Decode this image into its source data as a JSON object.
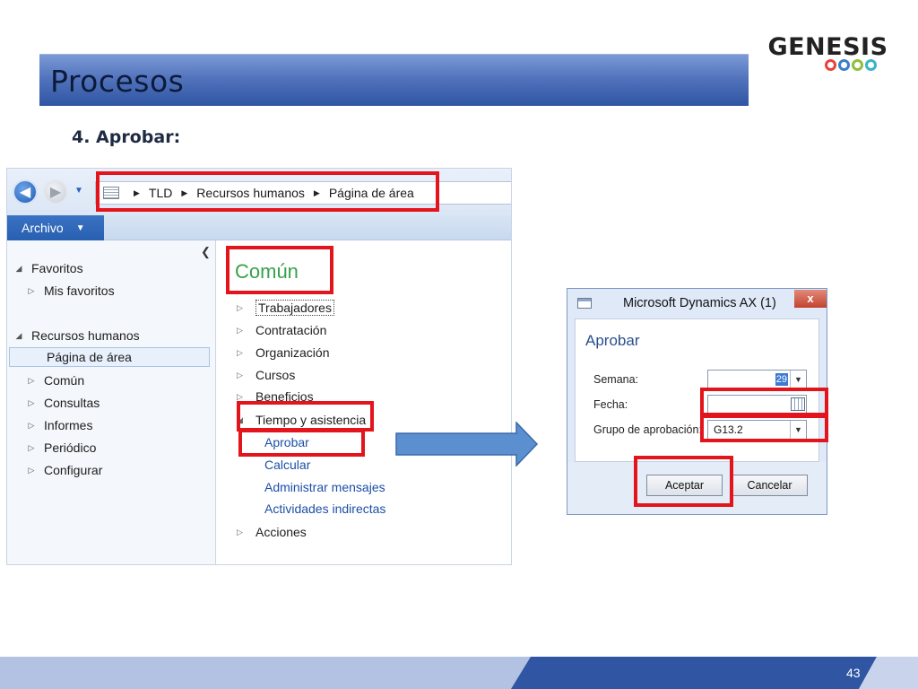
{
  "slide": {
    "title": "Procesos",
    "subtitle": "4. Aprobar:",
    "page_number": "43",
    "logo_text": "GENESIS",
    "logo_ring_colors": [
      "#e8423a",
      "#3a7fc9",
      "#8fbf3b",
      "#3bb3c9"
    ]
  },
  "ax_window": {
    "breadcrumb": [
      "TLD",
      "Recursos humanos",
      "Página de área"
    ],
    "file_tab": "Archivo",
    "nav_pane": {
      "favorites_header": "Favoritos",
      "my_favorites": "Mis favoritos",
      "module_header": "Recursos humanos",
      "items": [
        "Página de área",
        "Común",
        "Consultas",
        "Informes",
        "Periódico",
        "Configurar"
      ]
    },
    "content": {
      "section_title": "Común",
      "groups": [
        "Trabajadores",
        "Contratación",
        "Organización",
        "Cursos",
        "Beneficios"
      ],
      "expanded_group": "Tiempo y asistencia",
      "expanded_links": [
        "Aprobar",
        "Calcular",
        "Administrar mensajes",
        "Actividades indirectas"
      ],
      "last_group": "Acciones"
    }
  },
  "dialog": {
    "window_title": "Microsoft Dynamics AX (1)",
    "close_label": "x",
    "heading": "Aprobar",
    "fields": {
      "semana_label": "Semana:",
      "semana_value": "29",
      "fecha_label": "Fecha:",
      "fecha_value": "",
      "grupo_label": "Grupo de aprobación:",
      "grupo_value": "G13.2"
    },
    "ok_label": "Aceptar",
    "cancel_label": "Cancelar"
  },
  "colors": {
    "highlight": "#e3141b",
    "title_bar": "#3f63b0",
    "section_green": "#37a24a",
    "link_blue": "#1c4fa6",
    "footer_blue": "#2f55a3"
  }
}
